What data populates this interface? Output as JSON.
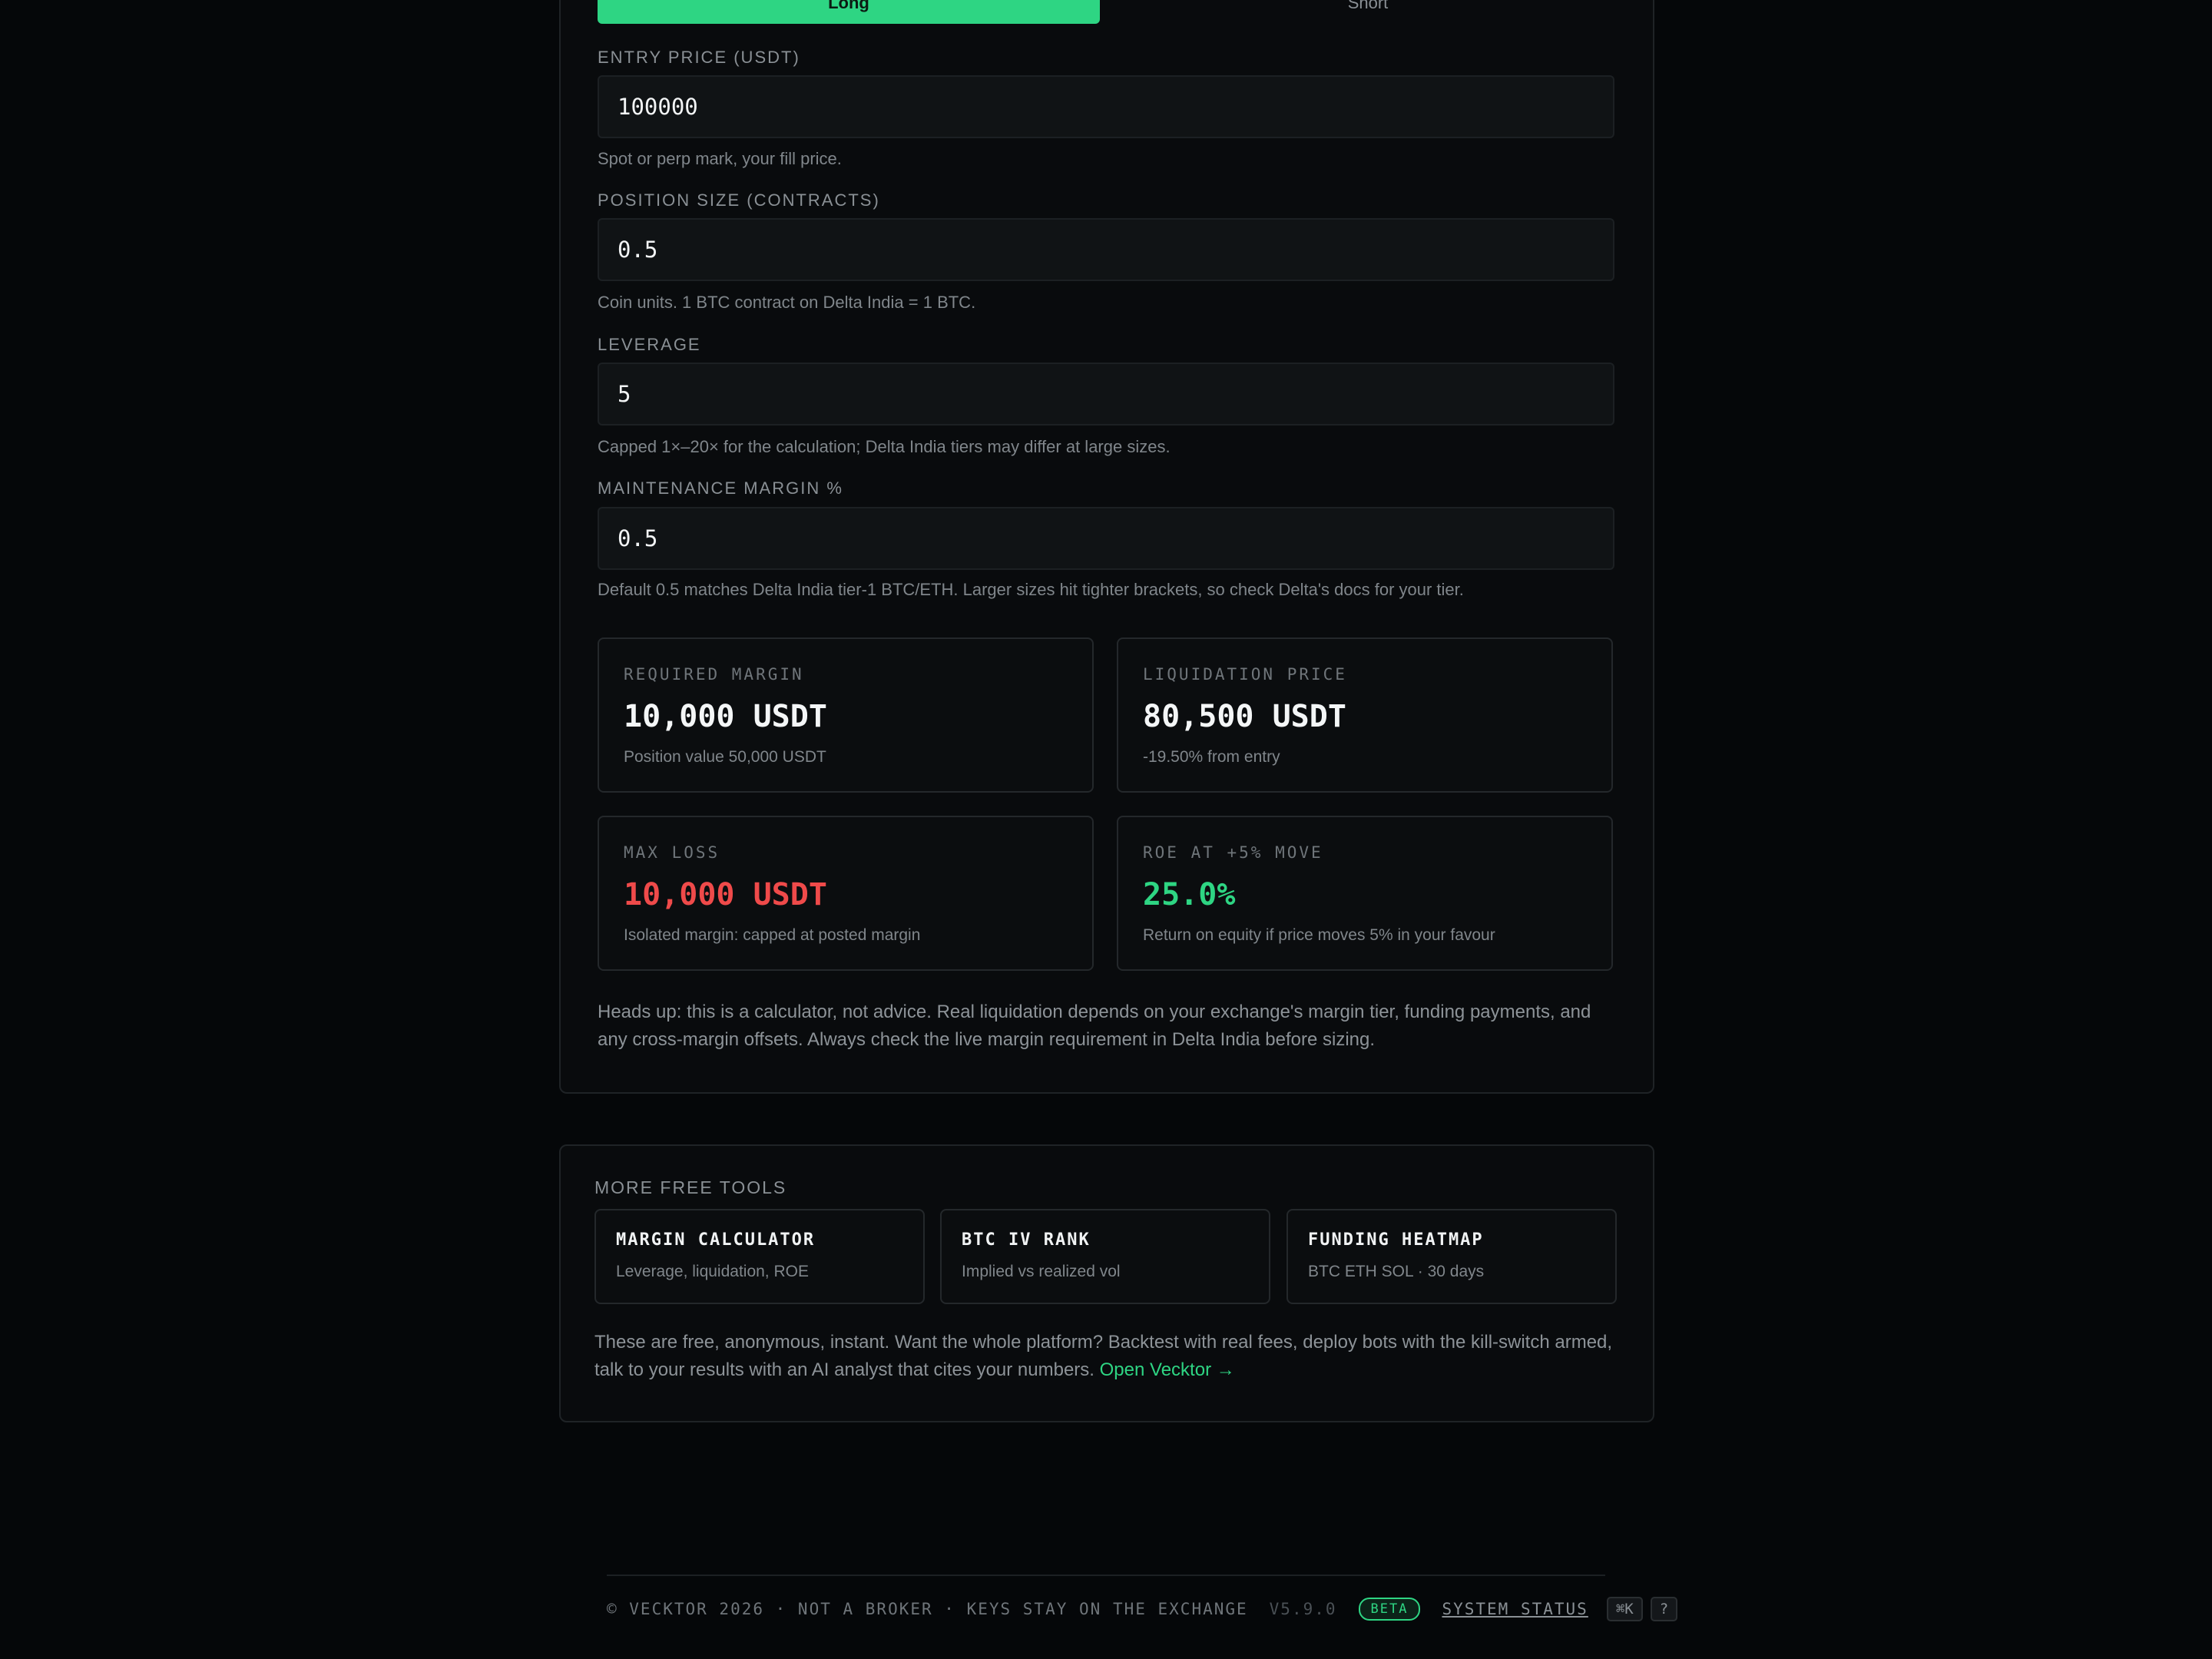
{
  "side": {
    "long_label": "Long",
    "short_label": "Short"
  },
  "fields": [
    {
      "label": "ENTRY PRICE (USDT)",
      "value": "100000",
      "hint": "Spot or perp mark, your fill price."
    },
    {
      "label": "POSITION SIZE (CONTRACTS)",
      "value": "0.5",
      "hint": "Coin units. 1 BTC contract on Delta India = 1 BTC."
    },
    {
      "label": "LEVERAGE",
      "value": "5",
      "hint": "Capped 1×–20× for the calculation; Delta India tiers may differ at large sizes."
    },
    {
      "label": "MAINTENANCE MARGIN %",
      "value": "0.5",
      "hint": "Default 0.5 matches Delta India tier-1 BTC/ETH. Larger sizes hit tighter brackets, so check Delta's docs for your tier."
    }
  ],
  "results": {
    "required_margin": {
      "label": "REQUIRED MARGIN",
      "value": "10,000 USDT",
      "note": "Position value 50,000 USDT"
    },
    "liquidation_price": {
      "label": "LIQUIDATION PRICE",
      "value": "80,500 USDT",
      "note": "-19.50% from entry"
    },
    "max_loss": {
      "label": "MAX LOSS",
      "value": "10,000 USDT",
      "note": "Isolated margin: capped at posted margin",
      "color": "#ef4a4a"
    },
    "roe": {
      "label": "ROE AT +5% MOVE",
      "value": "25.0%",
      "note": "Return on equity if price moves 5% in your favour",
      "color": "#2ed583"
    }
  },
  "disclaimer": "Heads up: this is a calculator, not advice. Real liquidation depends on your exchange's margin tier, funding payments, and any cross-margin offsets. Always check the live margin requirement in Delta India before sizing.",
  "tools": {
    "title": "MORE FREE TOOLS",
    "items": [
      {
        "name": "MARGIN CALCULATOR",
        "desc": "Leverage, liquidation, ROE"
      },
      {
        "name": "BTC IV RANK",
        "desc": "Implied vs realized vol"
      },
      {
        "name": "FUNDING HEATMAP",
        "desc": "BTC ETH SOL · 30 days"
      }
    ],
    "text": "These are free, anonymous, instant. Want the whole platform? Backtest with real fees, deploy bots with the kill-switch armed, talk to your results with an AI analyst that cites your numbers.",
    "link_label": "Open Vecktor →"
  },
  "footer": {
    "copyright": "© VECKTOR 2026 · NOT A BROKER · KEYS STAY ON THE EXCHANGE",
    "version": "V5.9.0",
    "badge": "BETA",
    "status_link": "SYSTEM STATUS",
    "shortcut": "⌘K",
    "help": "?"
  },
  "colors": {
    "accent": "#2ed583",
    "danger": "#ef4a4a",
    "background": "#050709"
  }
}
